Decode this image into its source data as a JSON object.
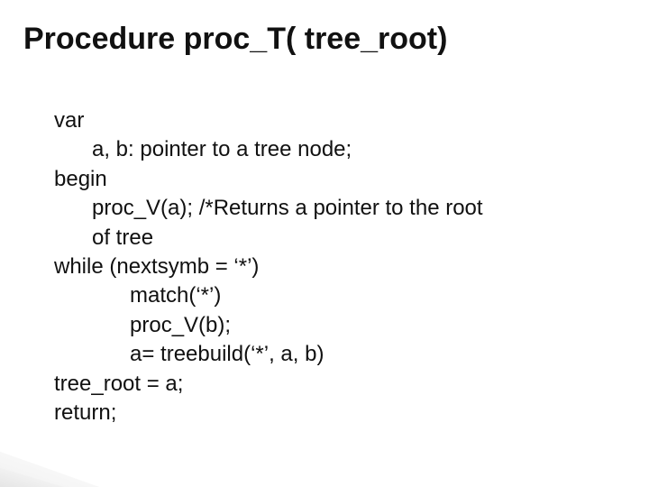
{
  "title": "Procedure proc_T( tree_root)",
  "code": {
    "l0_var": "var",
    "l1_ab": "a, b: pointer to a tree node;",
    "l0_begin": "begin",
    "l1_procv": "proc_V(a); /*Returns a pointer to the root",
    "l1_oftree": "of tree",
    "l0_while": "while (nextsymb = ‘*’)",
    "l2_match": "match(‘*’)",
    "l2_procvb": "proc_V(b);",
    "l2_assign": "a= treebuild(‘*’, a, b)",
    "l0_treeroot": "tree_root = a;",
    "l0_return": "return;"
  }
}
